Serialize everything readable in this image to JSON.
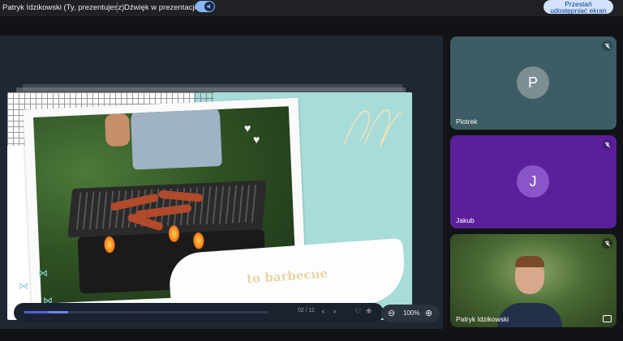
{
  "topbar": {
    "presenter": "Patryk Idzikowski (Ty, prezentujesz)",
    "sound_label": "Dźwięk w prezentacji",
    "sound_enabled": true,
    "stop_button": "Przestań\nudostępniać ekran"
  },
  "slide": {
    "text": "to barbecue",
    "page": "02 / 11",
    "progress_fraction": 0.18
  },
  "zoom": {
    "label": "100%"
  },
  "participants": [
    {
      "name": "Piotrek",
      "initial": "P",
      "muted": true,
      "color": "#3e5c64"
    },
    {
      "name": "Jakub",
      "initial": "J",
      "muted": true,
      "color": "#5b1f9c"
    },
    {
      "name": "Patryk Idzikowski",
      "muted": true,
      "video": true
    }
  ],
  "icons": {
    "prev": "‹",
    "next": "›",
    "heart": "♡",
    "grid": "⁜",
    "zoom_out": "⊖",
    "zoom_in": "⊕",
    "mic_off": "✕",
    "speaker": "◀"
  }
}
